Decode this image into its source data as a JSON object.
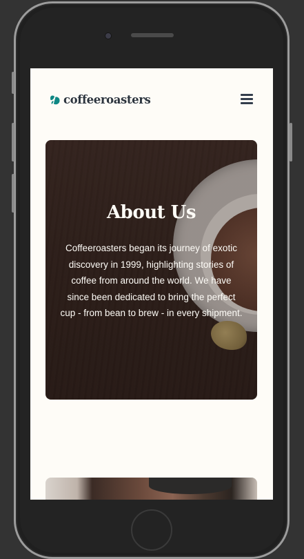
{
  "header": {
    "logo_text": "coffeeroasters",
    "logo_icon": "coffee-bean-icon",
    "menu_icon": "hamburger-menu-icon"
  },
  "hero": {
    "title": "About Us",
    "body": "Coffeeroasters began its journey of exotic discovery in 1999, highlighting stories of coffee from around the world. We have since been dedicated to bring the perfect cup - from bean to brew - in every shipment."
  },
  "colors": {
    "brand_teal": "#0e8784",
    "text_dark": "#2c343e",
    "background": "#fefcf7"
  }
}
